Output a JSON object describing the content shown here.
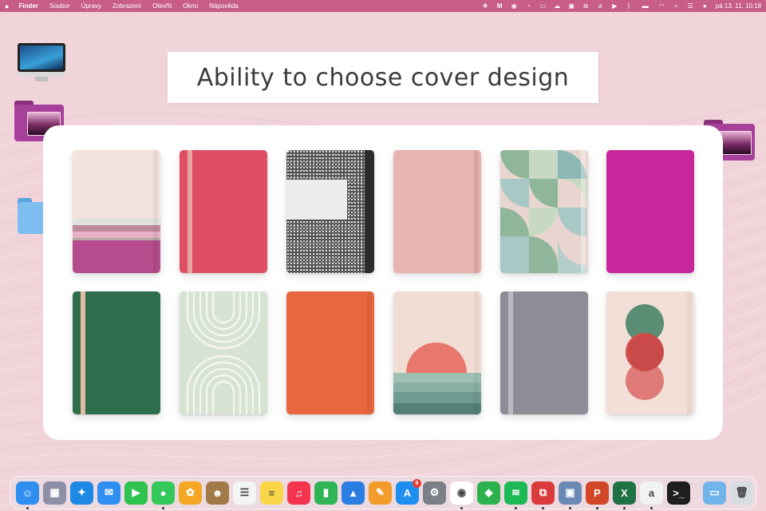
{
  "menubar": {
    "apple_icon": "apple-icon",
    "items": [
      "Finder",
      "Soubor",
      "Úpravy",
      "Zobrazení",
      "Otevřít",
      "Okno",
      "Nápověda"
    ],
    "status_icons": [
      "dropbox-icon",
      "m-app-icon",
      "record-icon",
      "clock-icon",
      "window-icon",
      "cloud-icon",
      "display-icon",
      "screenshot-icon",
      "signature-icon",
      "play-icon",
      "bluetooth-icon",
      "battery-icon",
      "wifi-icon",
      "search-icon",
      "control-center-icon",
      "avatar-icon"
    ],
    "clock": "pá 13. 11.  10:18"
  },
  "desktop": {
    "icons": [
      "imac-icon",
      "purple-folder-icon",
      "blue-folder-icon",
      "purple-folder-right-icon"
    ]
  },
  "banner": {
    "title": "Ability to choose cover design"
  },
  "covers": [
    {
      "name": "cover-cream-striped",
      "base": "#f3e3dc"
    },
    {
      "name": "cover-red",
      "base": "#de4f65"
    },
    {
      "name": "cover-composition",
      "base": "#3a3a3a"
    },
    {
      "name": "cover-pink",
      "base": "#e8b4b2"
    },
    {
      "name": "cover-geometric",
      "base": "#c9d7c5"
    },
    {
      "name": "cover-magenta",
      "base": "#c8269b"
    },
    {
      "name": "cover-green",
      "base": "#2f6e4d"
    },
    {
      "name": "cover-arches",
      "base": "#d4e2d0"
    },
    {
      "name": "cover-orange",
      "base": "#e8673f"
    },
    {
      "name": "cover-sunset",
      "base": "#f1ddd4"
    },
    {
      "name": "cover-grey",
      "base": "#8d8d98"
    },
    {
      "name": "cover-circles",
      "base": "#f1dfd8"
    }
  ],
  "dock": {
    "apps": [
      {
        "name": "finder",
        "icon": "finder-icon",
        "color": "#2f8ff0",
        "glyph": "☺",
        "running": true
      },
      {
        "name": "launchpad",
        "icon": "launchpad-icon",
        "color": "#8c8fa5",
        "glyph": "▦",
        "running": false
      },
      {
        "name": "safari",
        "icon": "safari-icon",
        "color": "#1e88e5",
        "glyph": "✦",
        "running": false
      },
      {
        "name": "mail",
        "icon": "mail-icon",
        "color": "#2f8ef2",
        "glyph": "✉",
        "running": false
      },
      {
        "name": "facetime",
        "icon": "facetime-icon",
        "color": "#2ec24e",
        "glyph": "▶",
        "running": false
      },
      {
        "name": "messages",
        "icon": "messages-icon",
        "color": "#34c759",
        "glyph": "●",
        "running": true
      },
      {
        "name": "photos",
        "icon": "photos-icon",
        "color": "#f5a623",
        "glyph": "✿",
        "running": false
      },
      {
        "name": "contacts",
        "icon": "contacts-icon",
        "color": "#a27a4a",
        "glyph": "☻",
        "running": false
      },
      {
        "name": "reminders",
        "icon": "reminders-icon",
        "color": "#f4f4f4",
        "glyph": "☰",
        "running": false
      },
      {
        "name": "notes",
        "icon": "notes-icon",
        "color": "#f9d548",
        "glyph": "≡",
        "running": false
      },
      {
        "name": "music",
        "icon": "music-icon",
        "color": "#f5344e",
        "glyph": "♫",
        "running": false
      },
      {
        "name": "numbers",
        "icon": "numbers-icon",
        "color": "#2fb556",
        "glyph": "▮",
        "running": false
      },
      {
        "name": "keynote",
        "icon": "keynote-icon",
        "color": "#2a7de1",
        "glyph": "▲",
        "running": false
      },
      {
        "name": "pages",
        "icon": "pages-icon",
        "color": "#f39c2c",
        "glyph": "✎",
        "running": false
      },
      {
        "name": "app-store",
        "icon": "app-store-icon",
        "color": "#1f8ef1",
        "glyph": "A",
        "running": false,
        "badge": "6"
      },
      {
        "name": "system-preferences",
        "icon": "gear-icon",
        "color": "#7a7f87",
        "glyph": "⚙",
        "running": false
      },
      {
        "name": "chrome",
        "icon": "chrome-icon",
        "color": "#ffffff",
        "glyph": "◉",
        "running": true
      },
      {
        "name": "feedly",
        "icon": "feedly-icon",
        "color": "#2bb24c",
        "glyph": "◆",
        "running": false
      },
      {
        "name": "spotify",
        "icon": "spotify-icon",
        "color": "#1db954",
        "glyph": "≋",
        "running": true
      },
      {
        "name": "parallels",
        "icon": "parallels-icon",
        "color": "#d93b3b",
        "glyph": "⧉",
        "running": true
      },
      {
        "name": "preview",
        "icon": "preview-icon",
        "color": "#6b89b5",
        "glyph": "▣",
        "running": true
      },
      {
        "name": "powerpoint",
        "icon": "powerpoint-icon",
        "color": "#d24726",
        "glyph": "P",
        "running": true
      },
      {
        "name": "excel",
        "icon": "excel-icon",
        "color": "#1f7244",
        "glyph": "X",
        "running": true
      },
      {
        "name": "signature",
        "icon": "signature-icon",
        "color": "#f2f2f2",
        "glyph": "a",
        "running": true
      },
      {
        "name": "terminal",
        "icon": "terminal-icon",
        "color": "#1e1e1e",
        "glyph": ">_",
        "running": false
      },
      {
        "name": "downloads-folder",
        "icon": "folder-icon",
        "color": "#6fb5ea",
        "glyph": "▭",
        "running": false,
        "after_separator": true
      },
      {
        "name": "trash",
        "icon": "trash-icon",
        "color": "#d9dde3",
        "glyph": "🗑",
        "running": false
      }
    ]
  }
}
